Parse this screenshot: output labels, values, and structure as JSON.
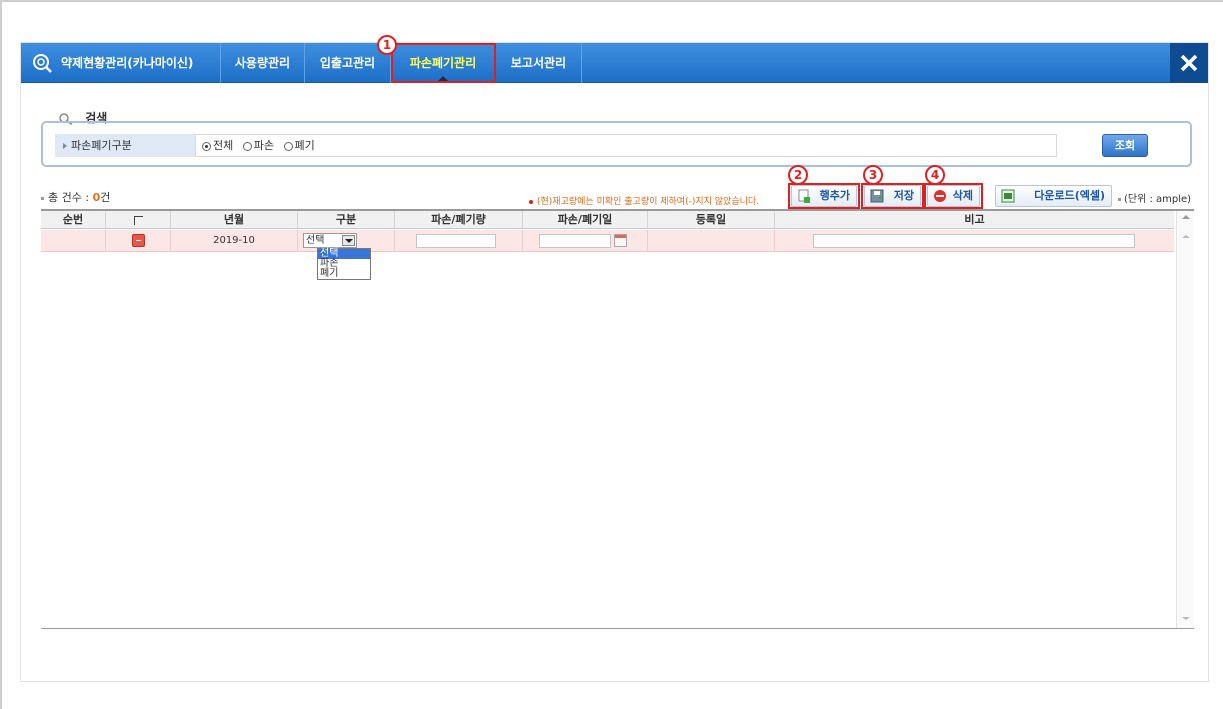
{
  "nav": {
    "title": "약제현황관리(카나마이신)",
    "tabs": [
      {
        "label": "사용량관리"
      },
      {
        "label": "입출고관리"
      },
      {
        "label": "파손폐기관리"
      },
      {
        "label": "보고서관리"
      }
    ]
  },
  "annotations": [
    "1",
    "2",
    "3",
    "4"
  ],
  "search": {
    "title": "검색",
    "field_label": "파손폐기구분",
    "options": [
      {
        "label": "전체",
        "checked": true
      },
      {
        "label": "파손",
        "checked": false
      },
      {
        "label": "폐기",
        "checked": false
      }
    ],
    "button_label": "조회"
  },
  "toolbar": {
    "count_label": "총 건수 : ",
    "count_value": "0",
    "count_unit": "건",
    "notice": "(현)재고량에는 미확인 출고량이 제하여(-)지지 않았습니다.",
    "add_row_label": "행추가",
    "save_label": "저장",
    "delete_label": "삭제",
    "download_label": "다운로드(엑셀)",
    "unit_label": "(단위 : ample)"
  },
  "table": {
    "columns": [
      "순번",
      "",
      "년월",
      "구분",
      "파손/폐기량",
      "파손/폐기일",
      "등록일",
      "비고"
    ],
    "rows": [
      {
        "seq": "",
        "year_month": "2019-10",
        "type": "선택",
        "qty": "",
        "date": "",
        "registered": "",
        "note": ""
      }
    ]
  },
  "dropdown": {
    "options": [
      "선택",
      "파손",
      "폐기"
    ],
    "selected": "선택"
  },
  "colors": {
    "header": "#1d6fc7",
    "active_tab_text": "#ffff66",
    "annotation": "#e02020",
    "row_highlight": "#fde6e6"
  }
}
